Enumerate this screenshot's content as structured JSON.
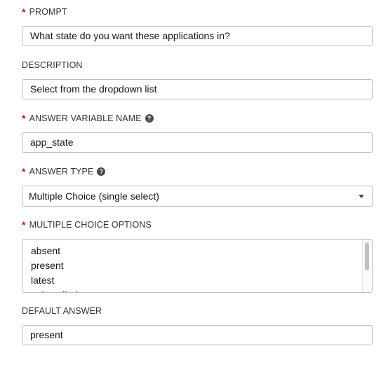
{
  "prompt": {
    "label": "PROMPT",
    "required_mark": "*",
    "value": "What state do you want these applications in?"
  },
  "description": {
    "label": "DESCRIPTION",
    "value": "Select from the dropdown list"
  },
  "answer_variable_name": {
    "label": "ANSWER VARIABLE NAME",
    "required_mark": "*",
    "help_icon": "question-circle-icon",
    "value": "app_state"
  },
  "answer_type": {
    "label": "ANSWER TYPE",
    "required_mark": "*",
    "help_icon": "question-circle-icon",
    "selected": "Multiple Choice (single select)"
  },
  "multiple_choice_options": {
    "label": "MULTIPLE CHOICE OPTIONS",
    "required_mark": "*",
    "lines": [
      "absent",
      "present",
      "latest",
      "uninstalled"
    ]
  },
  "default_answer": {
    "label": "DEFAULT ANSWER",
    "value": "present"
  },
  "colors": {
    "required": "#c9190b",
    "border": "#b8bbbe",
    "text": "#151515"
  }
}
